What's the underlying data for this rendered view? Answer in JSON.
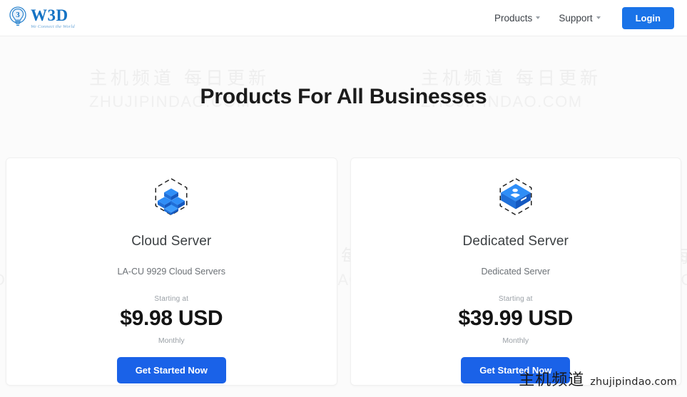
{
  "header": {
    "brand": {
      "name": "W3D",
      "tagline": "We Connect the World",
      "icon": "lightbulb-logo-icon"
    },
    "nav": [
      {
        "label": "Products",
        "icon": "chevron-down-icon"
      },
      {
        "label": "Support",
        "icon": "chevron-down-icon"
      }
    ],
    "login_label": "Login"
  },
  "hero": {
    "title": "Products For All Businesses"
  },
  "cards": [
    {
      "icon": "cloud-server-cubes-icon",
      "title": "Cloud Server",
      "subtitle": "LA-CU 9929 Cloud Servers",
      "starting_label": "Starting at",
      "price": "$9.98 USD",
      "period": "Monthly",
      "cta_label": "Get Started Now"
    },
    {
      "icon": "dedicated-server-box-icon",
      "title": "Dedicated Server",
      "subtitle": "Dedicated Server",
      "starting_label": "Starting at",
      "price": "$39.99 USD",
      "period": "Monthly",
      "cta_label": "Get Started Now"
    }
  ],
  "watermark": {
    "cn": "主机频道 每日更新",
    "en": "ZHUJIPINDAO.COM"
  },
  "corner_watermark": {
    "cn": "主机频道",
    "en": "zhujipindao.com"
  },
  "colors": {
    "accent_blue": "#1a73e8",
    "cta_blue": "#1a62e8",
    "brand_blue": "#1573c4",
    "page_bg": "#fbfbfb",
    "card_bg": "#ffffff",
    "watermark_gray": "#eeeeee"
  }
}
